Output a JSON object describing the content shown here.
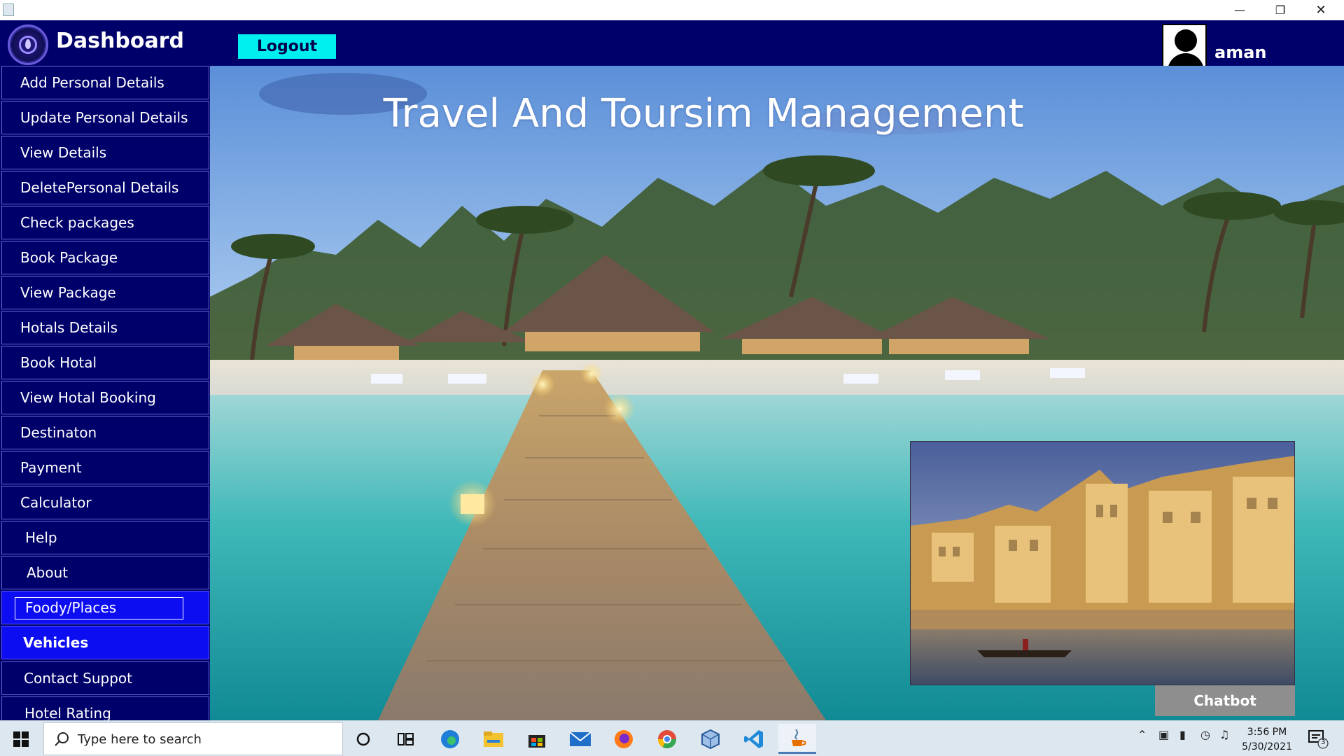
{
  "window": {
    "minimize_icon": "minimize-icon",
    "restore_icon": "restore-icon",
    "close_icon": "close-icon"
  },
  "header": {
    "title": "Dashboard",
    "logout_label": "Logout",
    "username": "aman",
    "colors": {
      "header_bg": "#00006b",
      "logout_bg": "#00f0f0"
    }
  },
  "sidebar": {
    "items": [
      {
        "label": "Add Personal Details"
      },
      {
        "label": "Update Personal Details"
      },
      {
        "label": "View Details"
      },
      {
        "label": "DeletePersonal Details"
      },
      {
        "label": "Check packages"
      },
      {
        "label": "Book Package"
      },
      {
        "label": "View Package"
      },
      {
        "label": "Hotals Details"
      },
      {
        "label": "Book Hotal"
      },
      {
        "label": "View Hotal Booking"
      },
      {
        "label": "Destinaton"
      },
      {
        "label": "Payment"
      },
      {
        "label": "Calculator"
      },
      {
        "label": "Help"
      },
      {
        "label": "About"
      },
      {
        "label": "Foody/Places",
        "state": "focused"
      },
      {
        "label": "Vehicles",
        "state": "selected"
      },
      {
        "label": "Contact Suppot"
      },
      {
        "label": "Hotel Rating"
      }
    ],
    "colors": {
      "item_bg": "#00006b",
      "active_bg": "#0d0df2"
    }
  },
  "main": {
    "title": "Travel And Toursim Management",
    "chatbot_label": "Chatbot"
  },
  "taskbar": {
    "search_placeholder": "Type here to search",
    "apps": [
      "cortana-icon",
      "task-view-icon",
      "edge-icon",
      "file-explorer-icon",
      "store-icon",
      "mail-icon",
      "firefox-icon",
      "chrome-icon",
      "virtualbox-icon",
      "vscode-icon",
      "java-icon"
    ],
    "time": "3:56 PM",
    "date": "5/30/2021",
    "notification_count": "3"
  }
}
